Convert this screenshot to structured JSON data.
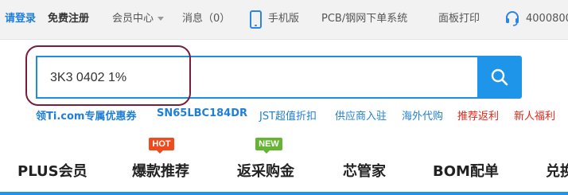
{
  "topbar": {
    "login": "请登录",
    "register": "免费注册",
    "member_center": "会员中心",
    "messages": "消息（0）",
    "mobile": "手机版",
    "pcb_order": "PCB/钢网下单系统",
    "panel_print": "面板打印",
    "phone": "4000800"
  },
  "search": {
    "value": "3K3 0402 1%",
    "button_icon": "search-icon"
  },
  "links": {
    "coupon": "领Ti.com专属优惠券",
    "part": "SN65LBC184DR",
    "jst": "JST超值折扣",
    "supplier": "供应商入驻",
    "overseas": "海外代购",
    "referral": "推荐返利",
    "newcomer": "新人福利"
  },
  "badges": {
    "hot": "HOT",
    "new": "NEW"
  },
  "nav": {
    "plus": "PLUS会员",
    "hot_picks": "爆款推荐",
    "cashback": "返采购金",
    "chip_steward": "芯管家",
    "bom": "BOM配单",
    "exchange": "兑换"
  },
  "colors": {
    "brand_blue": "#1f95ea",
    "link_blue": "#1f7fd8",
    "red": "#e0271b",
    "hot": "#ee4b1f",
    "new": "#66b532"
  }
}
